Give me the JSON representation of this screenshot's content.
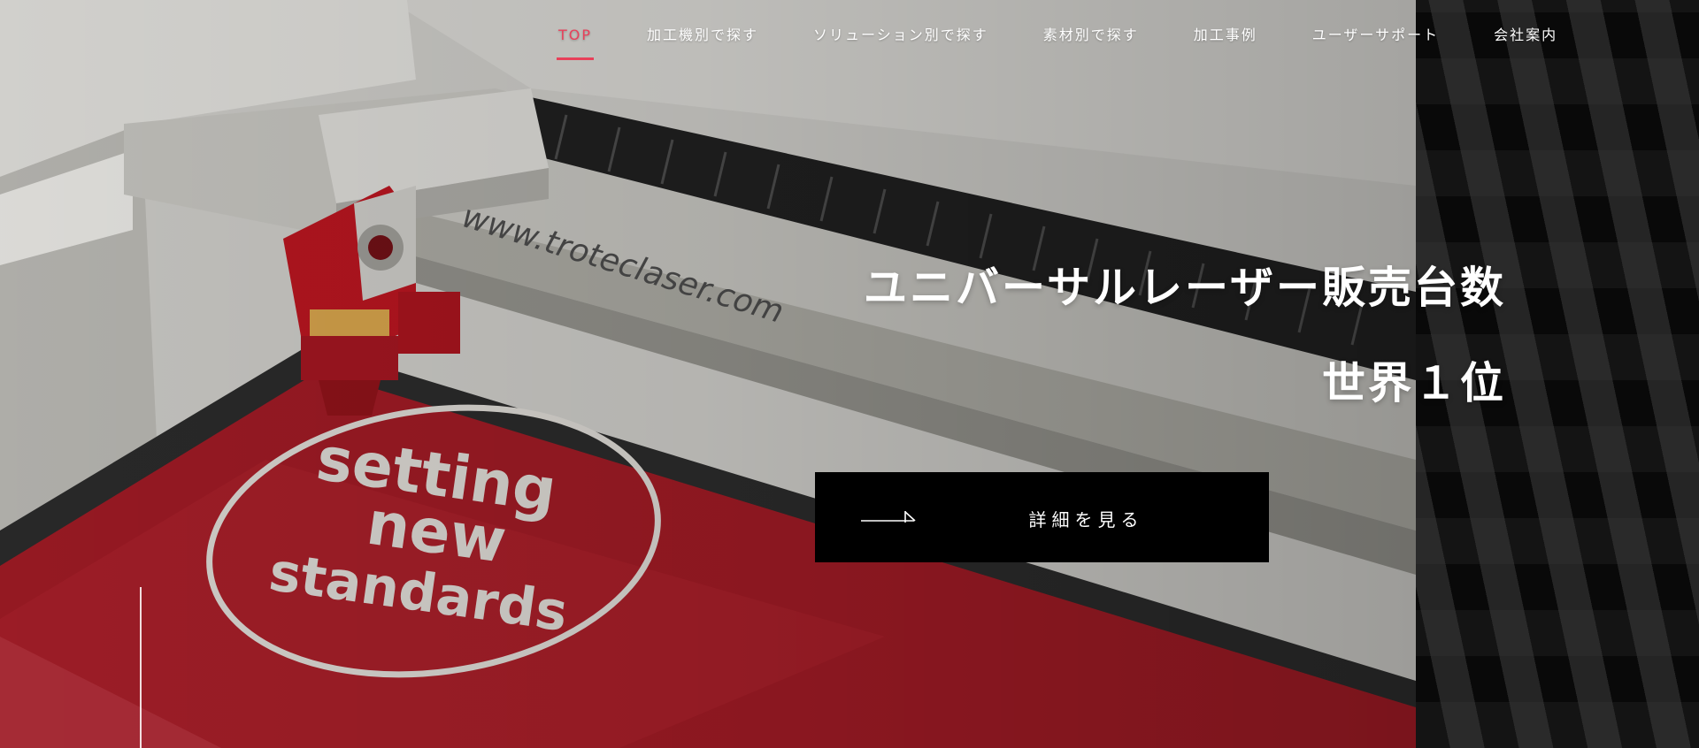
{
  "nav": {
    "items": [
      {
        "label": "TOP",
        "active": true
      },
      {
        "label": "加工機別で探す",
        "active": false
      },
      {
        "label": "ソリューション別で探す",
        "active": false
      },
      {
        "label": "素材別で探す",
        "active": false
      },
      {
        "label": "加工事例",
        "active": false
      },
      {
        "label": "ユーザーサポート",
        "active": false
      },
      {
        "label": "会社案内",
        "active": false
      }
    ]
  },
  "hero": {
    "headline_line1": "ユニバーサルレーザー販売台数",
    "headline_line2": "世界１位",
    "machine_url_text": "www.troteclaser.com",
    "badge_line1": "setting",
    "badge_line2": "new",
    "badge_line3": "standards"
  },
  "cta": {
    "label": "詳細を見る",
    "icon": "arrow-right-icon"
  },
  "colors": {
    "accent": "#e8405a",
    "cta_background": "#000000",
    "text": "#ffffff",
    "machine_red": "#9c1a24"
  }
}
